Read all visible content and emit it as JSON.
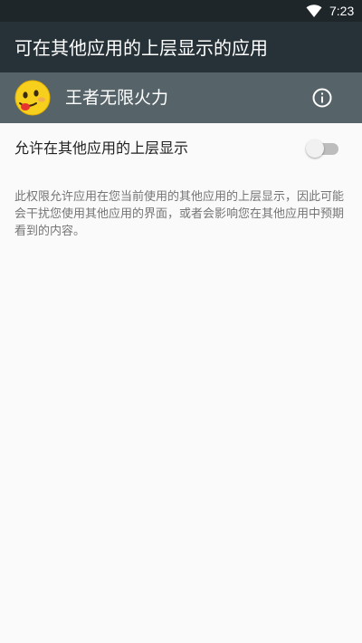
{
  "status_bar": {
    "time": "7:23",
    "wifi_icon": "wifi-full-icon"
  },
  "toolbar": {
    "title": "可在其他应用的上层显示的应用"
  },
  "app_header": {
    "app_name": "王者无限火力",
    "app_icon": "yellow-face-app-icon",
    "info_icon": "info-icon"
  },
  "setting": {
    "label": "允许在其他应用的上层显示",
    "enabled": false
  },
  "description": "此权限允许应用在您当前使用的其他应用的上层显示，因此可能会干扰您使用其他应用的界面，或者会影响您在其他应用中预期看到的内容。",
  "colors": {
    "status_bar": "#1f2629",
    "toolbar": "#263238",
    "app_header": "#56646a",
    "background": "#fafafa",
    "switch_track_off": "#bdbdbd",
    "switch_thumb_off": "#f1f1f1"
  }
}
